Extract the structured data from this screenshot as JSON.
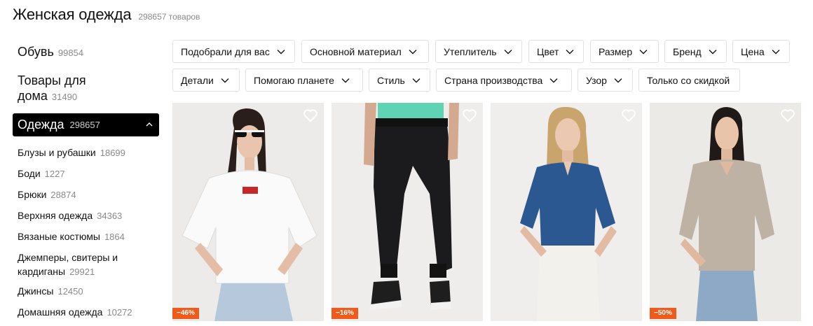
{
  "header": {
    "title": "Женская одежда",
    "count": "298657 товаров"
  },
  "sidebar": {
    "shoes": {
      "label": "Обувь",
      "count": "99854"
    },
    "home": {
      "label_line1": "Товары для",
      "label_line2": "дома",
      "count": "31490"
    },
    "clothes": {
      "label": "Одежда",
      "count": "298657"
    },
    "subcategories": [
      {
        "label": "Блузы и рубашки",
        "count": "18699"
      },
      {
        "label": "Боди",
        "count": "1227"
      },
      {
        "label": "Брюки",
        "count": "28874"
      },
      {
        "label": "Верхняя одежда",
        "count": "34363"
      },
      {
        "label": "Вязаные костюмы",
        "count": "1864"
      },
      {
        "label": "Джемперы, свитеры и кардиганы",
        "count": "29921"
      },
      {
        "label": "Джинсы",
        "count": "12450"
      },
      {
        "label": "Домашняя одежда",
        "count": "10272"
      }
    ]
  },
  "filters": [
    {
      "label": "Подобрали для вас",
      "dropdown": true
    },
    {
      "label": "Основной материал",
      "dropdown": true
    },
    {
      "label": "Утеплитель",
      "dropdown": true
    },
    {
      "label": "Цвет",
      "dropdown": true
    },
    {
      "label": "Размер",
      "dropdown": true
    },
    {
      "label": "Бренд",
      "dropdown": true
    },
    {
      "label": "Цена",
      "dropdown": true
    },
    {
      "label": "Детали",
      "dropdown": true
    },
    {
      "label": "Помогаю планете",
      "dropdown": true
    },
    {
      "label": "Стиль",
      "dropdown": true
    },
    {
      "label": "Страна производства",
      "dropdown": true
    },
    {
      "label": "Узор",
      "dropdown": true
    },
    {
      "label": "Только со скидкой",
      "dropdown": false
    }
  ],
  "products": [
    {
      "image": "white-oversized-tshirt-photo",
      "discount": "−46%"
    },
    {
      "image": "black-jogger-pants-photo",
      "discount": "−16%"
    },
    {
      "image": "blue-denim-shirt-photo",
      "discount": ""
    },
    {
      "image": "beige-linen-shirt-photo",
      "discount": "−50%"
    }
  ],
  "colors": {
    "accent": "#000000",
    "discount_badge": "#f05a1a",
    "chip_border": "#e2e2e2",
    "muted": "#8a8a8a"
  },
  "icons": {
    "favorite": "heart-outline-icon",
    "dropdown": "chevron-down-icon",
    "collapse": "chevron-up-icon"
  }
}
